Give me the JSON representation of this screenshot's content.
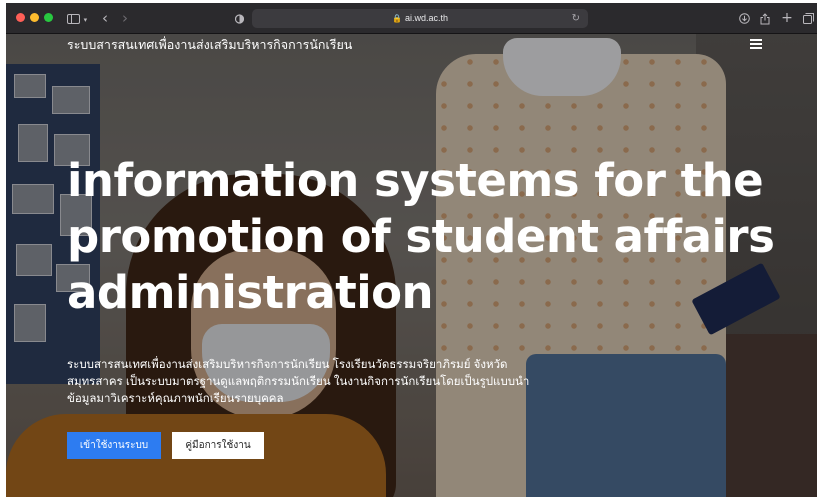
{
  "browser": {
    "traffic_lights": [
      "#ff5f57",
      "#febc2e",
      "#28c840"
    ],
    "url": "ai.wd.ac.th",
    "icons": {
      "sidebar": "sidebar-icon",
      "back": "chevron-left-icon",
      "forward": "chevron-right-icon",
      "privacy": "shield-icon",
      "lock": "lock-icon",
      "reload": "reload-icon",
      "download": "download-icon",
      "share": "share-icon",
      "new_tab": "plus-icon",
      "tabs": "tab-overview-icon"
    }
  },
  "site": {
    "brand": "ระบบสารสนเทศเพื่องานส่งเสริมบริหารกิจการนักเรียน",
    "menu_icon": "hamburger-menu-icon",
    "headline": "information systems for the promotion of student affairs administration",
    "description": "ระบบสารสนเทศเพื่องานส่งเสริมบริหารกิจการนักเรียน โรงเรียนวัดธรรมจริยาภิรมย์ จังหวัดสมุทรสาคร เป็นระบบมาตรฐานดูแลพฤติกรรมนักเรียน ในงานกิจการนักเรียนโดยเป็นรูปแบบนำข้อมูลมาวิเคราะห์คุณภาพนักเรียนรายบุคคล",
    "buttons": {
      "login": "เข้าใช้งานระบบ",
      "manual": "คู่มือการใช้งาน"
    }
  },
  "colors": {
    "primary_button": "#2d7cf1",
    "toolbar": "#2b2a2d"
  }
}
